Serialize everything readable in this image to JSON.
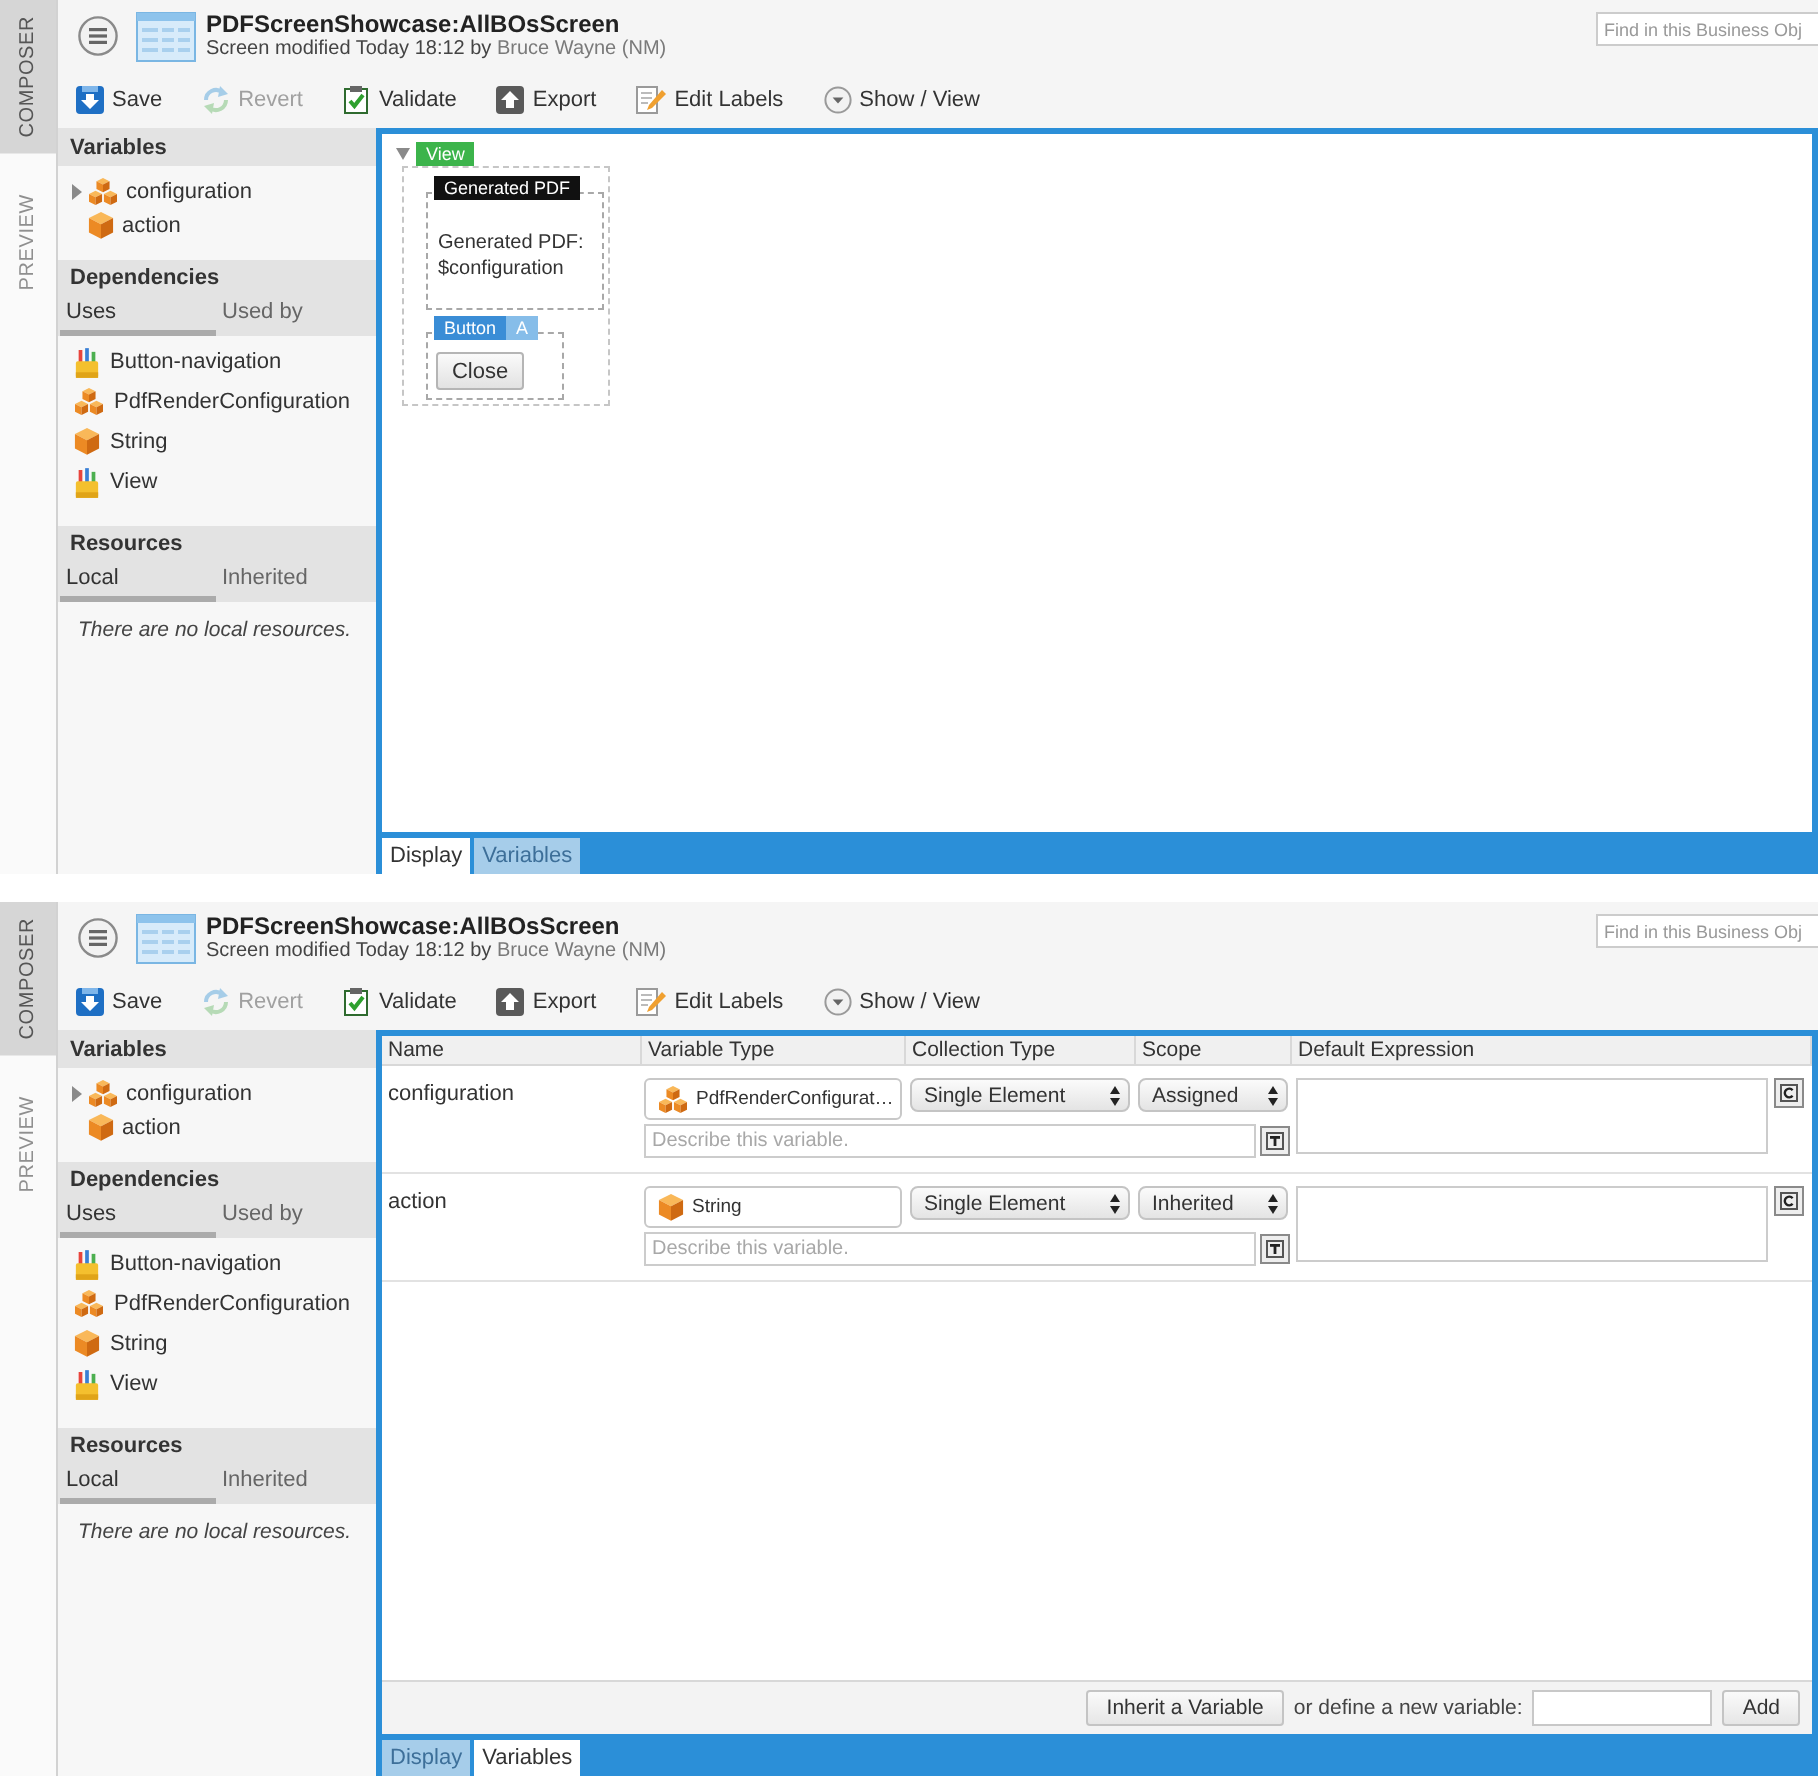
{
  "panels": [
    {
      "side_tabs": [
        {
          "label": "COMPOSER",
          "selected": true
        },
        {
          "label": "PREVIEW",
          "selected": false
        }
      ],
      "header": {
        "title": "PDFScreenShowcase:AllBOsScreen",
        "modified": "Screen modified Today 18:12 by",
        "author": "Bruce Wayne (NM)",
        "search_placeholder": "Find in this Business Obj"
      },
      "toolbar": [
        {
          "kind": "save",
          "label": "Save",
          "disabled": false
        },
        {
          "kind": "revert",
          "label": "Revert",
          "disabled": true
        },
        {
          "kind": "validate",
          "label": "Validate",
          "disabled": false
        },
        {
          "kind": "export",
          "label": "Export",
          "disabled": false
        },
        {
          "kind": "edit-labels",
          "label": "Edit Labels",
          "disabled": false
        },
        {
          "kind": "show-view",
          "label": "Show / View",
          "disabled": false
        }
      ],
      "sidebar": {
        "variables": {
          "title": "Variables",
          "items": [
            {
              "label": "configuration",
              "kind": "cubes",
              "expandable": true
            },
            {
              "label": "action",
              "kind": "cube",
              "expandable": false
            }
          ]
        },
        "dependencies": {
          "title": "Dependencies",
          "tabs": [
            {
              "label": "Uses",
              "selected": true
            },
            {
              "label": "Used by",
              "selected": false
            }
          ],
          "items": [
            {
              "label": "Button-navigation",
              "kind": "screen"
            },
            {
              "label": "PdfRenderConfiguration",
              "kind": "cubes"
            },
            {
              "label": "String",
              "kind": "cube"
            },
            {
              "label": "View",
              "kind": "screen"
            }
          ]
        },
        "resources": {
          "title": "Resources",
          "tabs": [
            {
              "label": "Local",
              "selected": true
            },
            {
              "label": "Inherited",
              "selected": false
            }
          ],
          "empty_text": "There are no local resources."
        }
      },
      "main": {
        "kind": "canvas",
        "root": {
          "label": "View",
          "expanded": true,
          "children": [
            {
              "kind": "text",
              "tag": "Generated PDF",
              "text": "Generated PDF: $configuration"
            },
            {
              "kind": "button",
              "tag": "Button",
              "badge": "A",
              "label": "Close"
            }
          ]
        }
      },
      "bottom_tabs": [
        {
          "label": "Display",
          "selected": true
        },
        {
          "label": "Variables",
          "selected": false
        }
      ]
    },
    {
      "side_tabs": [
        {
          "label": "COMPOSER",
          "selected": true
        },
        {
          "label": "PREVIEW",
          "selected": false
        }
      ],
      "header": {
        "title": "PDFScreenShowcase:AllBOsScreen",
        "modified": "Screen modified Today 18:12 by",
        "author": "Bruce Wayne (NM)",
        "search_placeholder": "Find in this Business Obj"
      },
      "toolbar": [
        {
          "kind": "save",
          "label": "Save",
          "disabled": false
        },
        {
          "kind": "revert",
          "label": "Revert",
          "disabled": true
        },
        {
          "kind": "validate",
          "label": "Validate",
          "disabled": false
        },
        {
          "kind": "export",
          "label": "Export",
          "disabled": false
        },
        {
          "kind": "edit-labels",
          "label": "Edit Labels",
          "disabled": false
        },
        {
          "kind": "show-view",
          "label": "Show / View",
          "disabled": false
        }
      ],
      "sidebar": {
        "variables": {
          "title": "Variables",
          "items": [
            {
              "label": "configuration",
              "kind": "cubes",
              "expandable": true
            },
            {
              "label": "action",
              "kind": "cube",
              "expandable": false
            }
          ]
        },
        "dependencies": {
          "title": "Dependencies",
          "tabs": [
            {
              "label": "Uses",
              "selected": true
            },
            {
              "label": "Used by",
              "selected": false
            }
          ],
          "items": [
            {
              "label": "Button-navigation",
              "kind": "screen"
            },
            {
              "label": "PdfRenderConfiguration",
              "kind": "cubes"
            },
            {
              "label": "String",
              "kind": "cube"
            },
            {
              "label": "View",
              "kind": "screen"
            }
          ]
        },
        "resources": {
          "title": "Resources",
          "tabs": [
            {
              "label": "Local",
              "selected": true
            },
            {
              "label": "Inherited",
              "selected": false
            }
          ],
          "empty_text": "There are no local resources."
        }
      },
      "main": {
        "kind": "variables",
        "columns": [
          "Name",
          "Variable Type",
          "Collection Type",
          "Scope",
          "Default Expression"
        ],
        "rows": [
          {
            "name": "configuration",
            "type": {
              "label": "PdfRenderConfigurat…",
              "kind": "cubes"
            },
            "collection": "Single Element",
            "scope": "Assigned",
            "description_placeholder": "Describe this variable."
          },
          {
            "name": "action",
            "type": {
              "label": "String",
              "kind": "cube"
            },
            "collection": "Single Element",
            "scope": "Inherited",
            "description_placeholder": "Describe this variable."
          }
        ],
        "footer": {
          "inherit_button": "Inherit a Variable",
          "define_label": "or define a new variable:",
          "add_button": "Add"
        }
      },
      "bottom_tabs": [
        {
          "label": "Display",
          "selected": false
        },
        {
          "label": "Variables",
          "selected": true
        }
      ]
    }
  ]
}
